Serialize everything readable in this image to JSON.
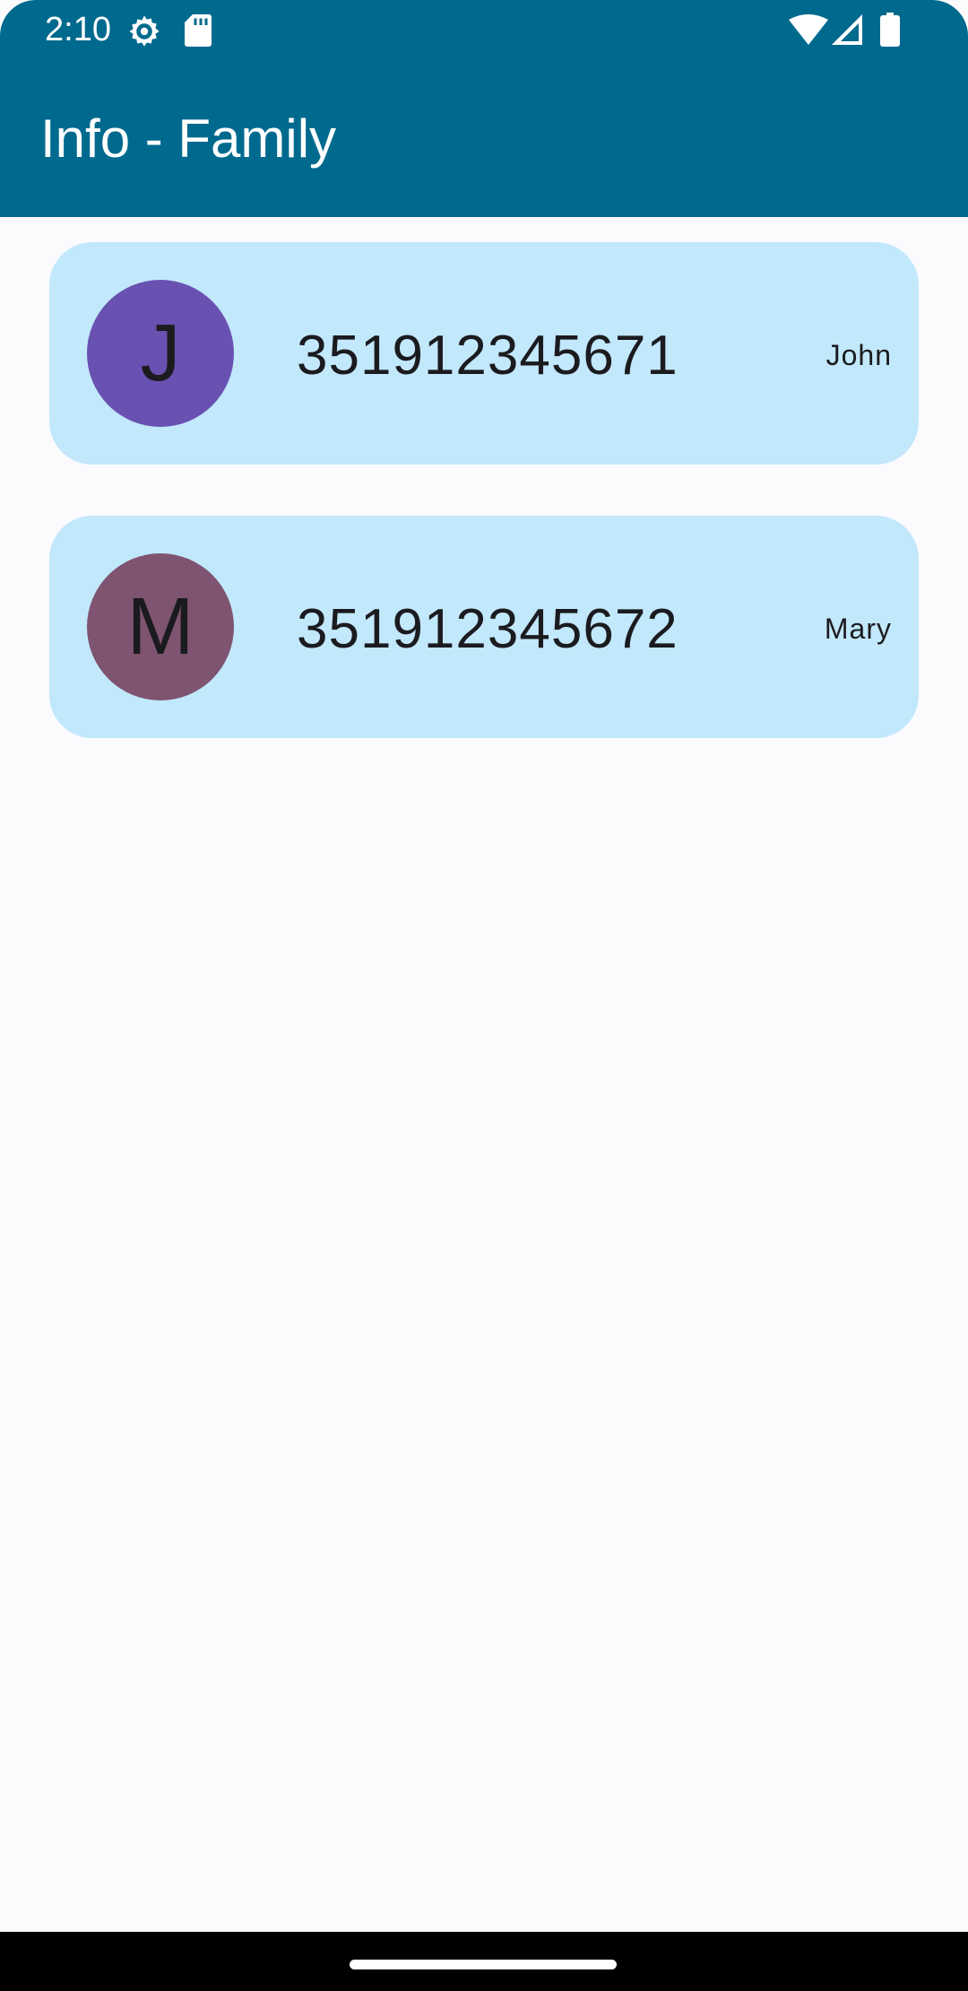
{
  "status_bar": {
    "time": "2:10",
    "icons": [
      "settings-gear-icon",
      "sd-card-icon",
      "wifi-icon",
      "cellular-signal-icon",
      "battery-icon"
    ]
  },
  "app_bar": {
    "title": "Info - Family",
    "background_color": "#006a8e"
  },
  "contacts": [
    {
      "initial": "J",
      "phone": "351912345671",
      "name": "John",
      "avatar_color": "#6951b1"
    },
    {
      "initial": "M",
      "phone": "351912345672",
      "name": "Mary",
      "avatar_color": "#7e5470"
    }
  ],
  "colors": {
    "card_background": "#c2e8fc",
    "page_background": "#fbfbfe"
  }
}
